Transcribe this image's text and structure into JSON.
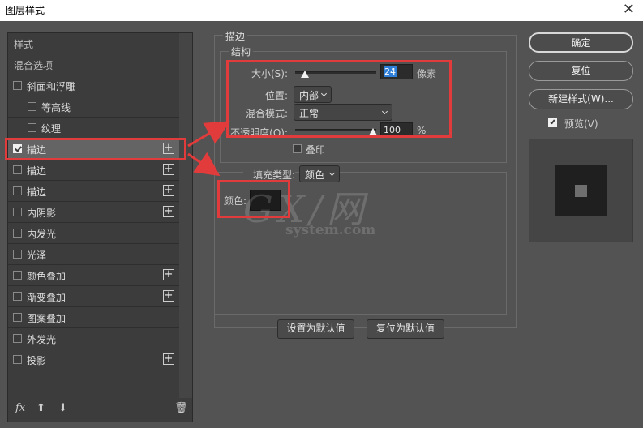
{
  "window": {
    "title": "图层样式",
    "close_glyph": "✕"
  },
  "left_panel": {
    "items": [
      {
        "label": "样式",
        "checkbox": false,
        "checked": false,
        "plus": false,
        "indent": false,
        "head": true
      },
      {
        "label": "混合选项",
        "checkbox": false,
        "checked": false,
        "plus": false,
        "indent": false,
        "head": true
      },
      {
        "label": "斜面和浮雕",
        "checkbox": true,
        "checked": false,
        "plus": false,
        "indent": false
      },
      {
        "label": "等高线",
        "checkbox": true,
        "checked": false,
        "plus": false,
        "indent": true
      },
      {
        "label": "纹理",
        "checkbox": true,
        "checked": false,
        "plus": false,
        "indent": true
      },
      {
        "label": "描边",
        "checkbox": true,
        "checked": true,
        "plus": true,
        "indent": false,
        "selected": true
      },
      {
        "label": "描边",
        "checkbox": true,
        "checked": false,
        "plus": true,
        "indent": false
      },
      {
        "label": "描边",
        "checkbox": true,
        "checked": false,
        "plus": true,
        "indent": false
      },
      {
        "label": "内阴影",
        "checkbox": true,
        "checked": false,
        "plus": true,
        "indent": false
      },
      {
        "label": "内发光",
        "checkbox": true,
        "checked": false,
        "plus": false,
        "indent": false
      },
      {
        "label": "光泽",
        "checkbox": true,
        "checked": false,
        "plus": false,
        "indent": false
      },
      {
        "label": "颜色叠加",
        "checkbox": true,
        "checked": false,
        "plus": true,
        "indent": false
      },
      {
        "label": "渐变叠加",
        "checkbox": true,
        "checked": false,
        "plus": true,
        "indent": false
      },
      {
        "label": "图案叠加",
        "checkbox": true,
        "checked": false,
        "plus": false,
        "indent": false
      },
      {
        "label": "外发光",
        "checkbox": true,
        "checked": false,
        "plus": false,
        "indent": false
      },
      {
        "label": "投影",
        "checkbox": true,
        "checked": false,
        "plus": true,
        "indent": false
      }
    ],
    "footer": {
      "fx": "fx",
      "up": "⬆",
      "down": "⬇",
      "trash": "🗑"
    }
  },
  "stroke": {
    "section_title": "描边",
    "structure_title": "结构",
    "size_label": "大小(S):",
    "size_value": "24",
    "size_unit": "像素",
    "size_level": 0.12,
    "position_label": "位置:",
    "position_value": "内部",
    "blend_label": "混合模式:",
    "blend_value": "正常",
    "opacity_label": "不透明度(O):",
    "opacity_value": "100",
    "opacity_unit": "%",
    "opacity_level": 1.0,
    "overprint_label": "叠印",
    "fill_type_label": "填充类型:",
    "fill_type_value": "颜色",
    "color_label": "颜色:",
    "color_value": "#1c1c1c"
  },
  "buttons": {
    "set_default": "设置为默认值",
    "reset_default": "复位为默认值"
  },
  "right_panel": {
    "ok": "确定",
    "reset": "复位",
    "new_style": "新建样式(W)...",
    "preview_label": "预览(V)",
    "preview_checked": true
  },
  "watermark": {
    "big": "GX/网",
    "small": "system.com"
  },
  "highlight_color": "#e23b3b"
}
